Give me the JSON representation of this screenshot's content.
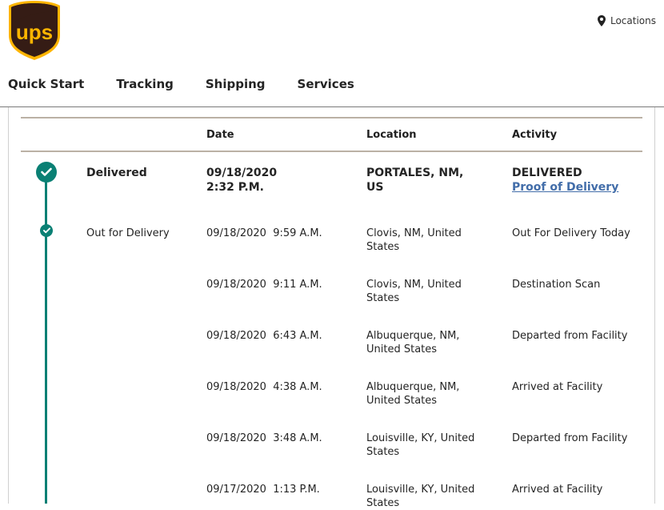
{
  "header": {
    "logo_text": "UPS",
    "locations_label": "Locations"
  },
  "nav": [
    "Quick Start",
    "Tracking",
    "Shipping",
    "Services"
  ],
  "table": {
    "headers": {
      "date": "Date",
      "location": "Location",
      "activity": "Activity"
    },
    "delivered": {
      "status": "Delivered",
      "date": "09/18/2020",
      "time": "2:32 P.M.",
      "location_line1": "PORTALES, NM,",
      "location_line2": "US",
      "activity": "DELIVERED",
      "link": "Proof of Delivery"
    },
    "rows": [
      {
        "status": "Out for Delivery",
        "datetime": "09/18/2020  9:59 A.M.",
        "loc1": "Clovis, NM, United",
        "loc2": "States",
        "activity": "Out For Delivery Today"
      },
      {
        "status": "",
        "datetime": "09/18/2020  9:11 A.M.",
        "loc1": "Clovis, NM, United",
        "loc2": "States",
        "activity": "Destination Scan"
      },
      {
        "status": "",
        "datetime": "09/18/2020  6:43 A.M.",
        "loc1": "Albuquerque, NM,",
        "loc2": "United States",
        "activity": "Departed from Facility"
      },
      {
        "status": "",
        "datetime": "09/18/2020  4:38 A.M.",
        "loc1": "Albuquerque, NM,",
        "loc2": "United States",
        "activity": "Arrived at Facility"
      },
      {
        "status": "",
        "datetime": "09/18/2020  3:48 A.M.",
        "loc1": "Louisville, KY, United",
        "loc2": "States",
        "activity": "Departed from Facility"
      },
      {
        "status": "",
        "datetime": "09/17/2020  1:13 P.M.",
        "loc1": "Louisville, KY, United",
        "loc2": "States",
        "activity": "Arrived at Facility"
      }
    ]
  },
  "colors": {
    "brand_brown": "#351c15",
    "brand_gold": "#ffb500",
    "timeline_green": "#0a8074",
    "link_blue": "#426da9"
  }
}
